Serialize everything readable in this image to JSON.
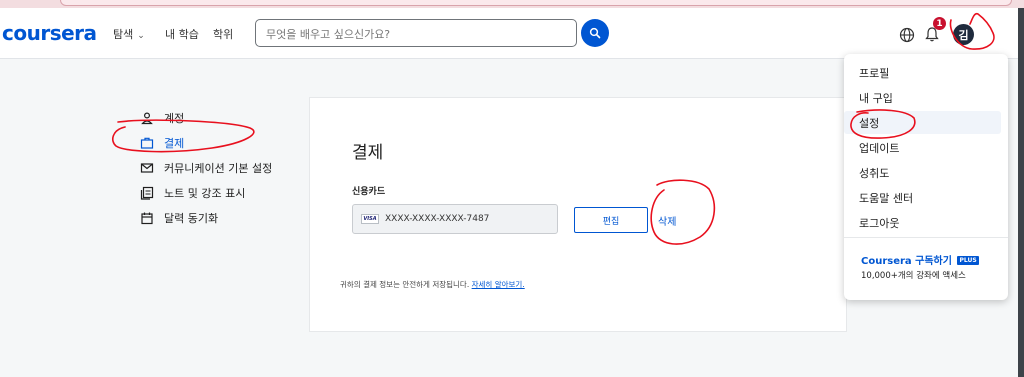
{
  "header": {
    "logo": "coursera",
    "nav": {
      "explore": "탐색",
      "my_learning": "내 학습",
      "degrees": "학위"
    },
    "search_placeholder": "무엇을 배우고 싶으신가요?",
    "notification_count": "1",
    "avatar_initial": "김",
    "icons": {
      "search": "search-icon",
      "language": "globe-icon",
      "notifications": "bell-icon",
      "explore_caret": "chevron-down-icon"
    }
  },
  "sidebar": {
    "items": [
      {
        "label": "계정",
        "icon": "person-icon"
      },
      {
        "label": "결제",
        "icon": "briefcase-icon",
        "active": true
      },
      {
        "label": "커뮤니케이션 기본 설정",
        "icon": "mail-icon"
      },
      {
        "label": "노트 및 강조 표시",
        "icon": "notes-icon"
      },
      {
        "label": "달력 동기화",
        "icon": "calendar-icon"
      }
    ]
  },
  "payment": {
    "title": "결제",
    "credit_card_label": "신용카드",
    "card_brand": "VISA",
    "card_number": "XXXX-XXXX-XXXX-7487",
    "edit_label": "편집",
    "delete_label": "삭제",
    "secure_text": "귀하의 결제 정보는 안전하게 저장됩니다.",
    "learn_more": "자세히 알아보기."
  },
  "dropdown": {
    "items": [
      "프로필",
      "내 구입",
      "설정",
      "업데이트",
      "성취도",
      "도움말 센터",
      "로그아웃"
    ],
    "highlighted": "설정",
    "plus": {
      "title": "Coursera 구독하기",
      "badge": "PLUS",
      "subtitle": "10,000+개의 강좌에 액세스"
    }
  },
  "colors": {
    "brand": "#0056d2",
    "annotation": "#e8101e",
    "badge": "#c8102e"
  }
}
